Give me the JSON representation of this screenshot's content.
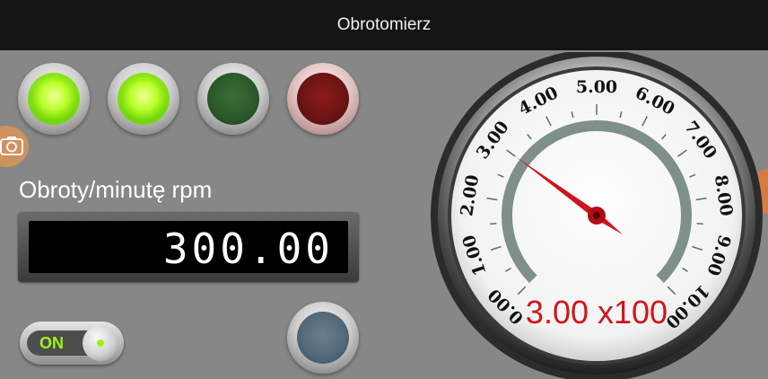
{
  "app": {
    "title": "Obrotomierz"
  },
  "indicators": [
    {
      "name": "led-1",
      "state": "on",
      "color": "#9ef21c"
    },
    {
      "name": "led-2",
      "state": "on",
      "color": "#9ef21c"
    },
    {
      "name": "led-3",
      "state": "off",
      "color": "#2c5a2a"
    },
    {
      "name": "led-4",
      "state": "off",
      "color": "#6d1414"
    }
  ],
  "camera": {
    "icon": "camera-icon"
  },
  "rpm": {
    "label": "Obroty/minutę rpm",
    "value": "300.00"
  },
  "toggle": {
    "label": "ON",
    "state": "on"
  },
  "action_button": {
    "icon": "round-button"
  },
  "gauge": {
    "tick_labels": [
      "0.00",
      "1.00",
      "2.00",
      "3.00",
      "4.00",
      "5.00",
      "6.00",
      "7.00",
      "8.00",
      "9.00",
      "10.00"
    ],
    "min": 0,
    "max": 10,
    "value": 3.0,
    "readout": "3.00 x100",
    "needle_color": "#d0141b",
    "readout_color": "#d0141b",
    "arc_color": "#7f8f8b"
  }
}
